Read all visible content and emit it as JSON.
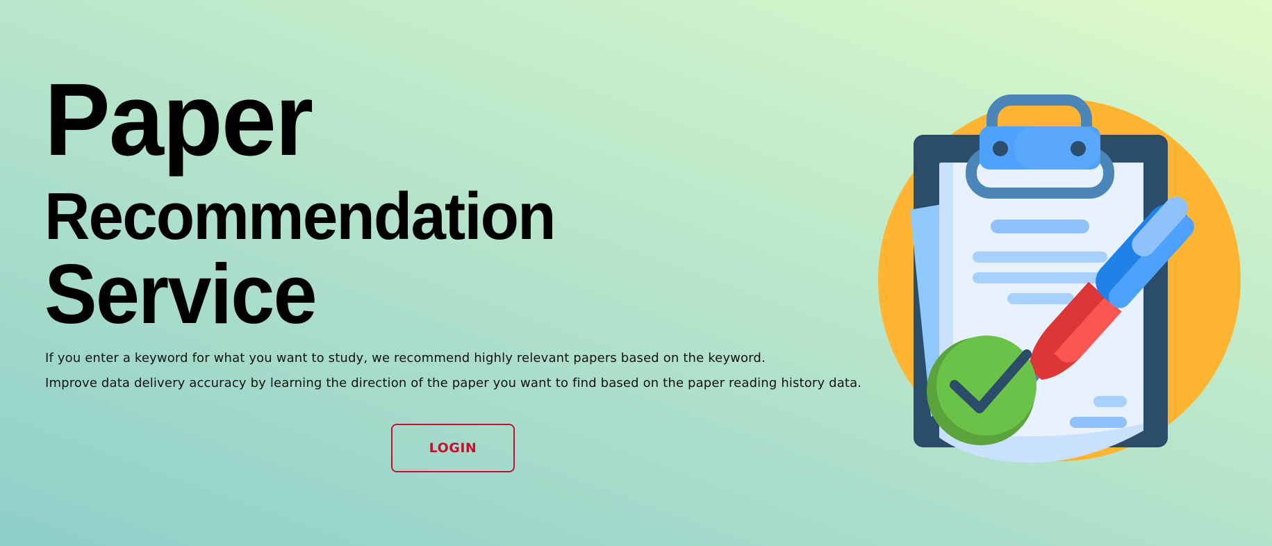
{
  "hero": {
    "title_line1": "Paper",
    "title_line2": "Recommendation",
    "title_line3": "Service",
    "description_line1": "If you enter a keyword for what you want to study, we recommend highly relevant papers based on the keyword.",
    "description_line2": "Improve data delivery accuracy by learning the direction of the paper you want to find based on the paper reading history data."
  },
  "actions": {
    "login_label": "LOGIN"
  },
  "illustration": {
    "icon": "clipboard-pen-checkmark-icon",
    "colors": {
      "circle": "#ffb531",
      "clipboard": "#2b4d69",
      "paper": "#e8f2ff",
      "clip": "#4ea1fc",
      "pen_blue": "#1e82e8",
      "pen_red": "#fc5652",
      "check": "#6ac248"
    }
  },
  "theme": {
    "accent": "#c8102e",
    "background_start": "#8ecfca",
    "background_end": "#e0fac9"
  }
}
